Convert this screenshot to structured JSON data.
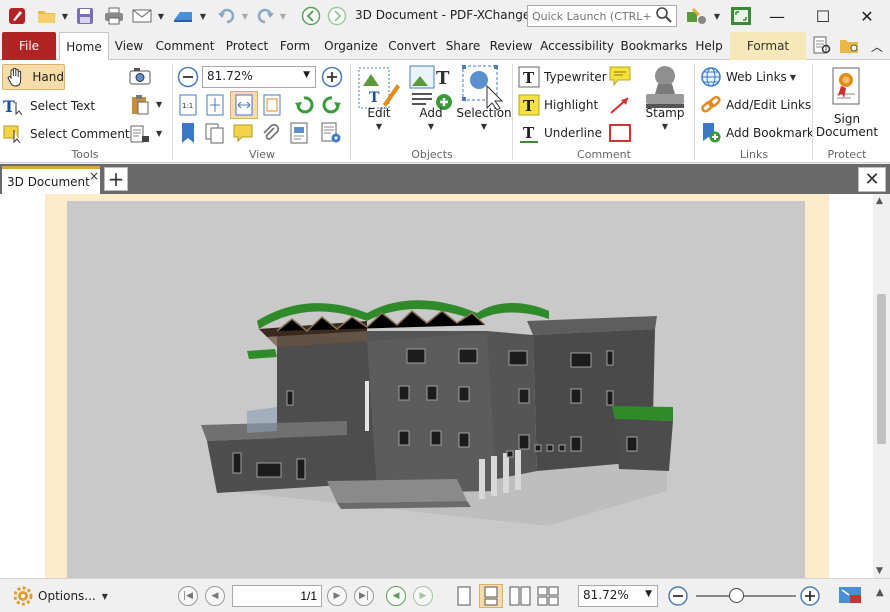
{
  "window": {
    "title": "3D Document - PDF-XChange ..",
    "quick_launch_placeholder": "Quick Launch (CTRL+.)",
    "minimize_symbol": "—",
    "maximize_symbol": "☐",
    "close_symbol": "✕"
  },
  "menu_tabs": {
    "file": "File",
    "home": "Home",
    "view": "View",
    "comment": "Comment",
    "protect": "Protect",
    "form": "Form",
    "organize": "Organize",
    "convert": "Convert",
    "share": "Share",
    "review": "Review",
    "accessibility": "Accessibility",
    "bookmarks": "Bookmarks",
    "help": "Help",
    "format": "Format"
  },
  "ribbon": {
    "tools": {
      "label": "Tools",
      "hand": "Hand",
      "select_text": "Select Text",
      "select_comments": "Select Comments"
    },
    "view": {
      "label": "View",
      "zoom_value": "81.72%"
    },
    "objects": {
      "label": "Objects",
      "edit": "Edit",
      "add": "Add",
      "selection": "Selection"
    },
    "comment": {
      "label": "Comment",
      "typewriter": "Typewriter",
      "highlight": "Highlight",
      "underline": "Underline",
      "stamp": "Stamp"
    },
    "links": {
      "label": "Links",
      "web_links": "Web Links",
      "add_edit_links": "Add/Edit Links",
      "add_bookmark": "Add Bookmark"
    },
    "protect": {
      "label": "Protect",
      "sign_line1": "Sign",
      "sign_line2": "Document"
    }
  },
  "document_tab": {
    "title": "3D Document",
    "close": "×",
    "new_tab": "+",
    "close_all": "✕"
  },
  "statusbar": {
    "options": "Options...",
    "page_value": "1/1",
    "zoom_value": "81.72%"
  },
  "colors": {
    "file_tab": "#b22424",
    "hand_active": "#f5dca8",
    "doc_tab_accent": "#e2a33a",
    "page_margin": "#fdeccb",
    "viewport_bg": "#c9c9c9",
    "roof_green": "#2f8a2a"
  }
}
